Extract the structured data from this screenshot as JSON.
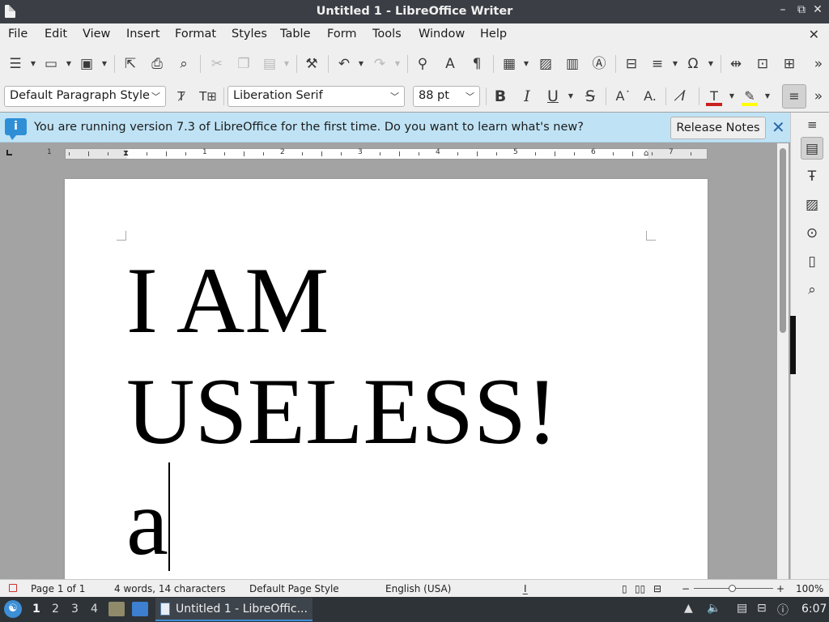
{
  "window": {
    "title": "Untitled 1 - LibreOffice Writer",
    "minimize": "–",
    "restore": "⧉",
    "close": "✕"
  },
  "menubar": {
    "items": [
      "File",
      "Edit",
      "View",
      "Insert",
      "Format",
      "Styles",
      "Table",
      "Form",
      "Tools",
      "Window",
      "Help"
    ],
    "close_doc": "✕"
  },
  "standard_toolbar": {
    "icons": [
      "new-icon",
      "open-icon",
      "save-icon",
      "export-pdf-icon",
      "print-icon",
      "print-preview-icon",
      "cut-icon",
      "copy-icon",
      "paste-icon",
      "clone-formatting-icon",
      "undo-icon",
      "redo-icon",
      "find-replace-icon",
      "spelling-icon",
      "formatting-marks-icon",
      "insert-table-icon",
      "insert-image-icon",
      "insert-chart-icon",
      "insert-textbox-icon",
      "page-break-icon",
      "insert-field-icon",
      "special-character-icon",
      "hyperlink-icon",
      "footnote-icon",
      "comment-icon",
      "overflow-icon"
    ]
  },
  "formatting_toolbar": {
    "paragraph_style": "Default Paragraph Style",
    "font_name": "Liberation Serif",
    "font_size": "88 pt"
  },
  "infobar": {
    "message": "You are running version 7.3 of LibreOffice for the first time. Do you want to learn what's new?",
    "button": "Release Notes",
    "close": "✕",
    "icon": "i"
  },
  "document": {
    "lines": [
      "I AM",
      "USELESS!",
      "a"
    ]
  },
  "ruler": {
    "numbers": [
      "1",
      "1",
      "2",
      "3",
      "4",
      "5",
      "6",
      "7"
    ]
  },
  "statusbar": {
    "page": "Page 1 of 1",
    "word_count": "4 words, 14 characters",
    "page_style": "Default Page Style",
    "language": "English (USA)",
    "zoom_minus": "−",
    "zoom_plus": "+",
    "zoom": "100%"
  },
  "taskbar": {
    "workspaces": [
      "1",
      "2",
      "3",
      "4"
    ],
    "active_window": "Untitled 1 - LibreOffic...",
    "clock": "6:07"
  },
  "colors": {
    "infobar_bg": "#bfe3f5",
    "accent": "#3d8fd6",
    "font_color": "#c9211e",
    "highlight_color": "#ffff00"
  }
}
